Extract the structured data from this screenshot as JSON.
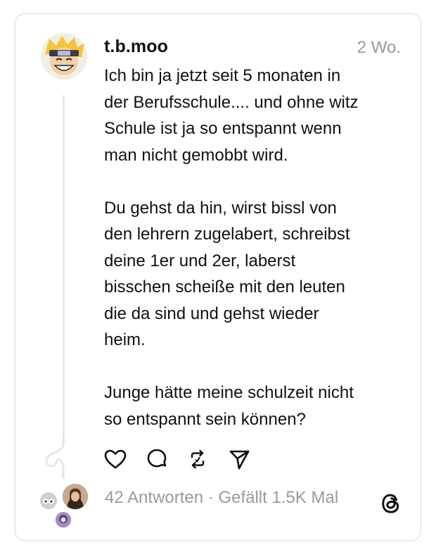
{
  "post": {
    "username": "t.b.moo",
    "time": "2 Wo.",
    "text": "Ich bin ja jetzt seit 5 monaten in\nder Berufsschule.... und ohne witz\nSchule ist ja so entspannt wenn\nman nicht gemobbt wird.\n\nDu gehst da hin, wirst bissl von\nden lehrern zugelabert, schreibst\ndeine 1er und 2er, laberst\nbisschen scheiße mit den leuten\ndie da sind und gehst wieder\nheim.\n\nJunge hätte meine schulzeit nicht\nso entspannt sein können?"
  },
  "actions": {
    "icons": [
      "heart-icon",
      "comment-icon",
      "repost-icon",
      "share-icon"
    ]
  },
  "stats": {
    "replies": "42 Antworten",
    "separator": " · ",
    "likes": "Gefällt 1.5K Mal"
  },
  "colors": {
    "text": "#111111",
    "muted": "#9a9a9a",
    "border": "#d9d9d9",
    "thread_line": "#e6e6e6"
  }
}
